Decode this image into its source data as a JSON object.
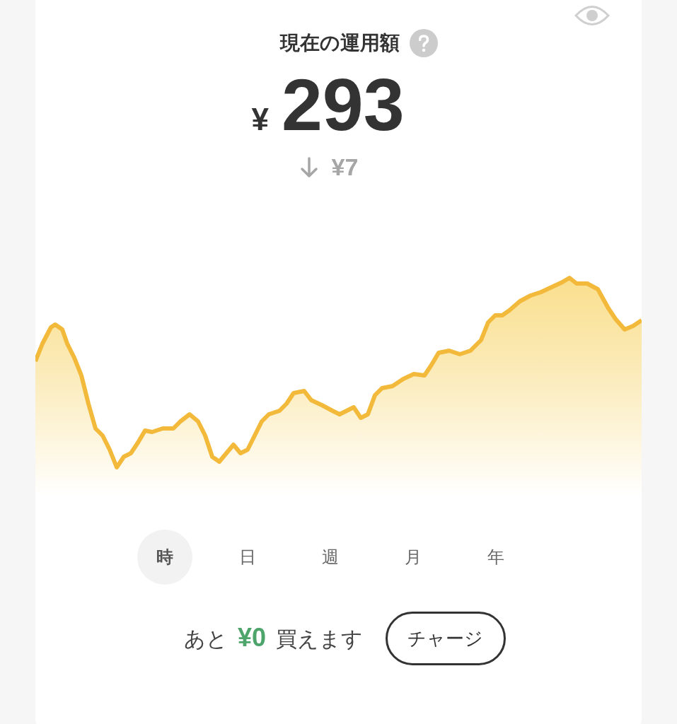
{
  "balance": {
    "title": "現在の運用額",
    "currency": "¥",
    "amount": "293",
    "change": "¥7"
  },
  "periods": [
    {
      "label": "時",
      "selected": true
    },
    {
      "label": "日",
      "selected": false
    },
    {
      "label": "週",
      "selected": false
    },
    {
      "label": "月",
      "selected": false
    },
    {
      "label": "年",
      "selected": false
    }
  ],
  "footer": {
    "message": "あと **¥0** 買えます",
    "button": "チャージ"
  }
}
